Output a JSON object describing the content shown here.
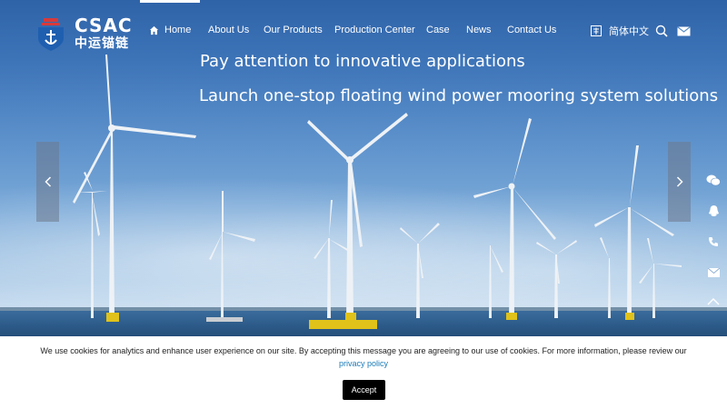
{
  "brand": {
    "name_en": "CSAC",
    "name_cn": "中运锚链"
  },
  "nav": {
    "items": [
      {
        "label": "Home",
        "icon": "home-icon"
      },
      {
        "label": "About Us"
      },
      {
        "label": "Our Products"
      },
      {
        "label": "Production Center"
      },
      {
        "label": "Case"
      },
      {
        "label": "News"
      },
      {
        "label": "Contact Us"
      }
    ],
    "language_label": "简体中文",
    "language_icon": "language-icon",
    "search_icon": "search-icon",
    "mail_icon": "mail-icon"
  },
  "hero": {
    "headline_1": "Pay attention to innovative applications",
    "headline_2": "Launch one-stop floating wind power mooring system solutions",
    "prev_icon": "chevron-left-icon",
    "next_icon": "chevron-right-icon"
  },
  "sidebar": {
    "icons": [
      "wechat-icon",
      "qq-icon",
      "phone-icon",
      "mail-icon",
      "back-to-top-icon"
    ]
  },
  "cookie": {
    "message": "We use cookies for analytics and enhance user experience on our site. By accepting this message you are agreeing to our use of cookies. For more information, please review our",
    "link_label": "privacy policy",
    "accept_label": "Accept"
  },
  "colors": {
    "accent_link": "#1a7bb9",
    "button_bg": "#000000",
    "logo_red": "#d83a3a",
    "logo_blue": "#1f5fb0"
  }
}
